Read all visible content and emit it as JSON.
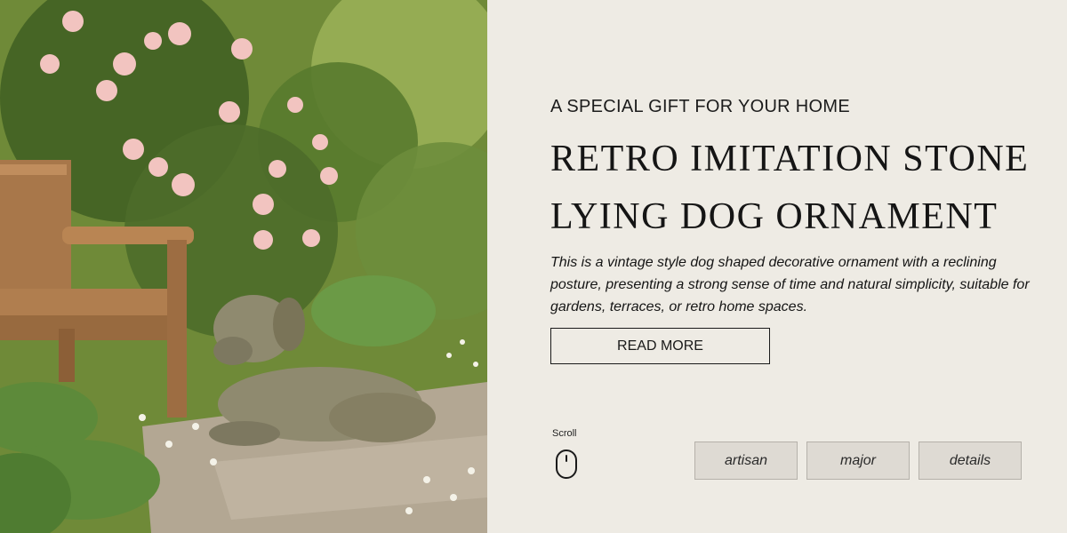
{
  "hero": {
    "image_alt": "Stone dog ornament lying on a garden path beside a wooden bench and pink roses"
  },
  "content": {
    "eyebrow": "A SPECIAL GIFT FOR YOUR HOME",
    "title_line1": "RETRO IMITATION STONE",
    "title_line2": "LYING DOG ORNAMENT",
    "description": "This is a vintage style dog shaped decorative ornament with a reclining posture, presenting a strong sense of time and natural simplicity, suitable for gardens, terraces, or retro home spaces.",
    "read_more_label": "READ MORE"
  },
  "scroll": {
    "label": "Scroll",
    "icon": "mouse-icon"
  },
  "tags": [
    {
      "label": "artisan"
    },
    {
      "label": "major"
    },
    {
      "label": "details"
    }
  ],
  "colors": {
    "background": "#eeebe4",
    "text": "#151515",
    "tag_bg": "#dedad3",
    "tag_border": "#b5b1aa"
  }
}
